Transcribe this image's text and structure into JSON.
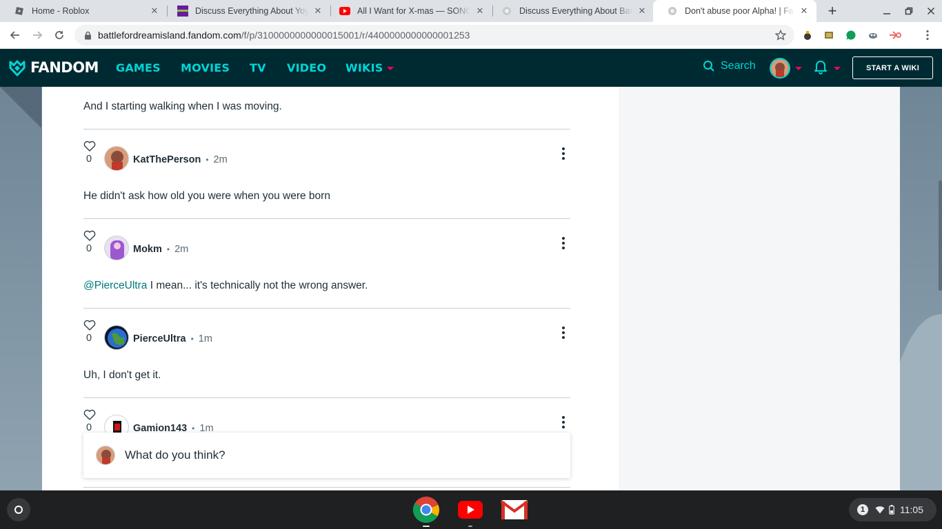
{
  "tabs": [
    {
      "title": "Home - Roblox",
      "icon": "roblox-icon"
    },
    {
      "title": "Discuss Everything About Yoylecake",
      "icon": "fandom-purple-icon"
    },
    {
      "title": "All I Want for X-mas — SONG by",
      "icon": "youtube-icon"
    },
    {
      "title": "Discuss Everything About Battle",
      "icon": "fandom-site-icon"
    },
    {
      "title": "Don't abuse poor Alpha! | Fandom",
      "icon": "fandom-site-icon",
      "active": true
    }
  ],
  "toolbar": {
    "url_host": "battlefordreamisland.fandom.com",
    "url_path": "/f/p/3100000000000015001/r/4400000000000001253"
  },
  "header": {
    "logo_text": "FANDOM",
    "nav": [
      "GAMES",
      "MOVIES",
      "TV",
      "VIDEO",
      "WIKIS"
    ],
    "search_label": "Search",
    "start_wiki_label": "START A WIKI"
  },
  "thread": {
    "first_text": "And I starting walking when I was moving.",
    "replies": [
      {
        "user": "KatThePerson",
        "time": "2m",
        "likes": "0",
        "mention": "",
        "body": "He didn't ask how old you were when you were born"
      },
      {
        "user": "Mokm",
        "time": "2m",
        "likes": "0",
        "mention": "@PierceUltra",
        "body": " I mean... it's technically not the wrong answer."
      },
      {
        "user": "PierceUltra",
        "time": "1m",
        "likes": "0",
        "mention": "",
        "body": "Uh, I don't get it."
      },
      {
        "user": "Gamion143",
        "time": "1m",
        "likes": "0",
        "mention": "",
        "body": ""
      }
    ],
    "composer_placeholder": "What do you think?"
  },
  "shelf": {
    "apps": [
      "chrome-icon",
      "youtube-icon",
      "gmail-icon"
    ],
    "notification_count": "1",
    "time": "11:05"
  },
  "colors": {
    "fandom_bg": "#002a32",
    "fandom_link": "#00d6d6",
    "fandom_accent": "#fa005a",
    "text": "#1e2d36",
    "mention": "#00797c"
  }
}
